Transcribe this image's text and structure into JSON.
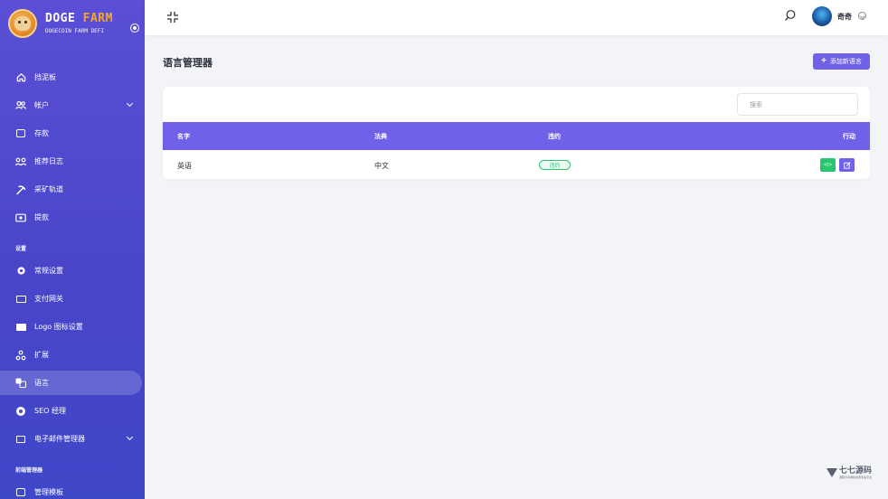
{
  "brand": {
    "title_main": "DOGE",
    "title_accent": "FARM",
    "subtitle": "DOGECOIN FARM DEFI",
    "accent_color": "#f5a623"
  },
  "sidebar": {
    "items": [
      {
        "label": "挡泥板",
        "icon": "home-icon"
      },
      {
        "label": "帐户",
        "icon": "users-icon",
        "has_children": true
      },
      {
        "label": "存款",
        "icon": "wallet-icon"
      },
      {
        "label": "推荐日志",
        "icon": "referral-icon"
      },
      {
        "label": "采矿轨道",
        "icon": "pickaxe-icon"
      },
      {
        "label": "提款",
        "icon": "withdraw-icon"
      }
    ],
    "section_settings": "设置",
    "settings_items": [
      {
        "label": "常规设置",
        "icon": "gear-icon"
      },
      {
        "label": "支付网关",
        "icon": "credit-card-icon"
      },
      {
        "label": "Logo 图标设置",
        "icon": "image-icon"
      },
      {
        "label": "扩展",
        "icon": "extension-icon"
      },
      {
        "label": "语言",
        "icon": "language-icon",
        "active": true
      },
      {
        "label": "SEO 经理",
        "icon": "globe-icon"
      },
      {
        "label": "电子邮件管理器",
        "icon": "mail-icon",
        "has_children": true
      }
    ],
    "section_frontend": "前端管理器",
    "frontend_items": [
      {
        "label": "管理模板",
        "icon": "template-icon"
      }
    ]
  },
  "header": {
    "user_name": "奇奇",
    "avatar": "avatar-image"
  },
  "main": {
    "page_title": "语言管理器",
    "add_button_label": "添加新语言",
    "search_placeholder": "搜索",
    "table": {
      "columns": [
        "名字",
        "法典",
        "违约",
        "行动"
      ],
      "rows": [
        {
          "name": "英语",
          "code": "中文",
          "default": "违约"
        }
      ]
    }
  },
  "watermark": {
    "text": "七七源码",
    "sub": "源码分享素材资源专业平台"
  },
  "colors": {
    "sidebar": "#4a45c8",
    "primary": "#6f62e8",
    "success": "#28c76f",
    "background": "#f3f4f7"
  }
}
